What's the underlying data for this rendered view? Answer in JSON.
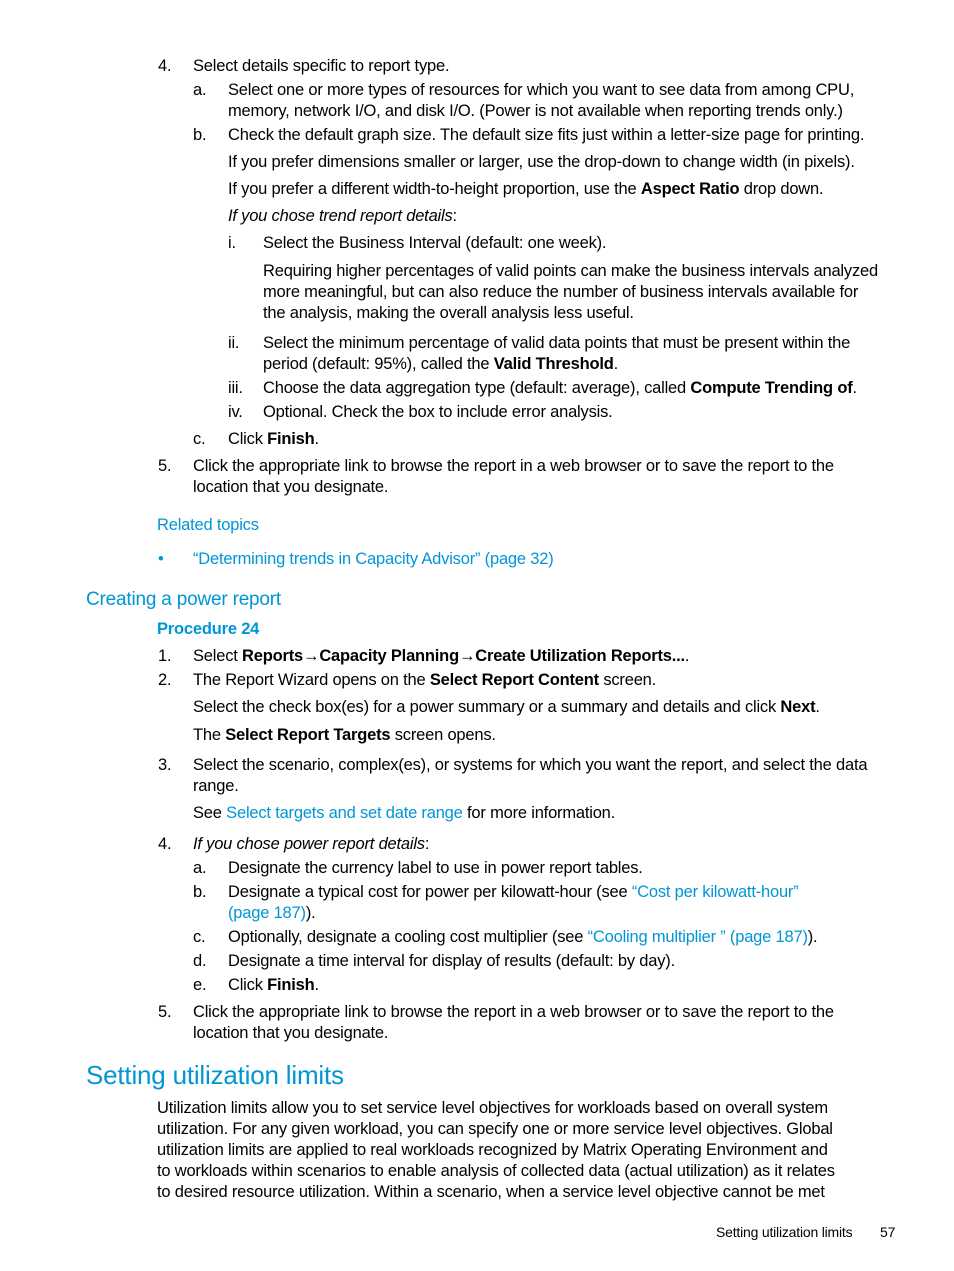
{
  "section_a": {
    "step4": {
      "num": "4.",
      "text": "Select details specific to report type."
    },
    "step4a": {
      "num": "a.",
      "line1": "Select one or more types of resources for which you want to see data from among CPU,",
      "line2": "memory, network I/O, and disk I/O. (Power is not available when reporting trends only.)"
    },
    "step4b": {
      "num": "b.",
      "text": "Check the default graph size. The default size fits just within a letter-size page for printing."
    },
    "para_dimensions": "If you prefer dimensions smaller or larger, use the drop-down to change width (in pixels).",
    "para_aspect": {
      "before": "If you prefer a different width-to-height proportion, use the ",
      "bold": "Aspect Ratio",
      "after": " drop down."
    },
    "para_trend": {
      "italic": "If you chose trend report details",
      "after": ":"
    },
    "sub_i": {
      "num": "i.",
      "text": "Select the Business Interval (default: one week)."
    },
    "para_requiring": {
      "line1": "Requiring higher percentages of valid points can make the business intervals analyzed",
      "line2": "more meaningful, but can also reduce the number of business intervals available for",
      "line3": "the analysis, making the overall analysis less useful."
    },
    "sub_ii": {
      "num": "ii.",
      "line1": "Select the minimum percentage of valid data points that must be present within the",
      "line2_before": "period (default: 95%), called the ",
      "line2_bold": "Valid Threshold",
      "line2_after": "."
    },
    "sub_iii": {
      "num": "iii.",
      "before": "Choose the data aggregation type (default: average), called ",
      "bold": "Compute Trending of",
      "after": "."
    },
    "sub_iv": {
      "num": "iv.",
      "text": "Optional. Check the box to include error analysis."
    },
    "step4c": {
      "num": "c.",
      "before": "Click ",
      "bold": "Finish",
      "after": "."
    },
    "step5": {
      "num": "5.",
      "line1": "Click the appropriate link to browse the report in a web browser or to save the report to the",
      "line2": "location that you designate."
    },
    "related_topics": "Related topics",
    "related_bullet": "•",
    "related_link": "“Determining trends in Capacity Advisor” (page 32)"
  },
  "power_report": {
    "heading": "Creating a power report",
    "procedure": "Procedure 24",
    "step1": {
      "num": "1.",
      "before": "Select ",
      "b1": "Reports",
      "arrow": "→",
      "b2": "Capacity Planning",
      "b3": "Create Utilization Reports...",
      "after": "."
    },
    "step2": {
      "num": "2.",
      "before": "The Report Wizard opens on the ",
      "bold": "Select Report Content",
      "after": " screen."
    },
    "para_checkbox": {
      "before": "Select the check box(es) for a power summary or a summary and details and click ",
      "bold": "Next",
      "after": "."
    },
    "para_targets": {
      "before": "The ",
      "bold": "Select Report Targets",
      "after": " screen opens."
    },
    "step3": {
      "num": "3.",
      "line1": "Select the scenario, complex(es), or systems for which you want the report, and select the data",
      "line2": "range."
    },
    "para_see": {
      "before": "See ",
      "link": "Select targets and set date range",
      "after": " for more information."
    },
    "step4": {
      "num": "4.",
      "italic": "If you chose power report details",
      "after": ":"
    },
    "step4a": {
      "num": "a.",
      "text": "Designate the currency label to use in power report tables."
    },
    "step4b": {
      "num": "b.",
      "before": "Designate a typical cost for power per kilowatt-hour (see ",
      "link1": "“Cost per kilowatt-hour”",
      "link2": "(page 187)",
      "after": ")."
    },
    "step4c": {
      "num": "c.",
      "before": "Optionally, designate a cooling cost multiplier (see ",
      "link": "“Cooling multiplier ” (page 187)",
      "after": ")."
    },
    "step4d": {
      "num": "d.",
      "text": "Designate a time interval for display of results (default: by day)."
    },
    "step4e": {
      "num": "e.",
      "before": "Click ",
      "bold": "Finish",
      "after": "."
    },
    "step5": {
      "num": "5.",
      "line1": "Click the appropriate link to browse the report in a web browser or to save the report to the",
      "line2": "location that you designate."
    }
  },
  "utilization_limits": {
    "heading": "Setting utilization limits",
    "lines": [
      "Utilization limits allow you to set service level objectives for workloads based on overall system",
      "utilization. For any given workload, you can specify one or more service level objectives. Global",
      "utilization limits are applied to real workloads recognized by Matrix Operating Environment and",
      "to workloads within scenarios to enable analysis of collected data (actual utilization) as it relates",
      "to desired resource utilization. Within a scenario, when a service level objective cannot be met"
    ]
  },
  "footer": {
    "section": "Setting utilization limits",
    "page": "57"
  }
}
